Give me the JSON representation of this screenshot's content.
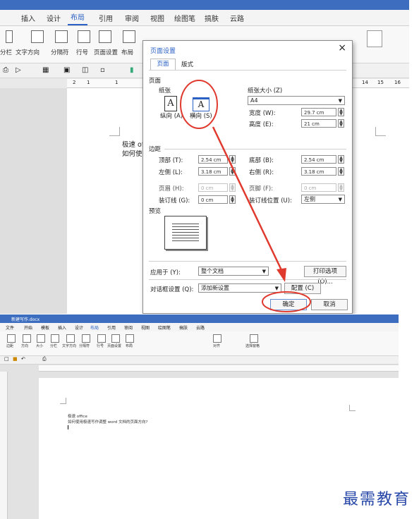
{
  "top_window": {
    "tabs": [
      "插入",
      "设计",
      "布局",
      "引用",
      "审阅",
      "视图",
      "绘图笔",
      "搞肤",
      "云路"
    ],
    "active_tab": "布局",
    "ribbon_labels": [
      "文字方向",
      "分隔符",
      "行号",
      "页面设置",
      "布局"
    ],
    "ribbon_left_fragment": "分栏",
    "ruler_numbers": [
      "2",
      "1",
      "1",
      "14",
      "15",
      "16"
    ],
    "doc_lines": [
      "极速 of",
      "如何使"
    ]
  },
  "dialog": {
    "title": "页面设置",
    "close_icon": "×",
    "tabs": [
      "页面",
      "版式"
    ],
    "section_page": "页面",
    "orientation_label": "纸张",
    "portrait_label": "纵向 (A)",
    "landscape_label": "横向 (S)",
    "paper_size_label": "纸张大小 (Z)",
    "paper_size_value": "A4",
    "width_label": "宽度 (W):",
    "width_value": "29.7 cm",
    "height_label": "高度 (E):",
    "height_value": "21 cm",
    "section_margins": "边距",
    "top_label": "顶部 (T):",
    "top_value": "2.54 cm",
    "bottom_label": "底部 (B):",
    "bottom_value": "2.54 cm",
    "left_label": "左侧 (L):",
    "left_value": "3.18 cm",
    "right_label": "右侧 (R):",
    "right_value": "3.18 cm",
    "header_label": "页眉 (H):",
    "header_value": "0 cm",
    "footer_label": "页脚 (F):",
    "footer_value": "0 cm",
    "gutter_label": "装订线 (G):",
    "gutter_value": "0 cm",
    "gutter_pos_label": "装订线位置 (U):",
    "gutter_pos_value": "左侧",
    "section_preview": "预览",
    "apply_label": "应用于 (Y):",
    "apply_value": "整个文档",
    "print_options": "打印选项 (O)...",
    "dialog_settings_label": "对话框设置 (Q):",
    "dialog_settings_value": "添加新设置",
    "config_button": "配置 (C)",
    "ok_button": "确定",
    "cancel_button": "取消"
  },
  "bottom_window": {
    "title": "新建写作.docx",
    "menu": [
      "文件",
      "开始",
      "模板",
      "插入",
      "设计",
      "布局",
      "引用",
      "审阅",
      "视图",
      "绘图笔",
      "搞肤",
      "云路"
    ],
    "active_menu": "布局",
    "ribbon_labels": [
      "边距",
      "方向",
      "大小",
      "分栏",
      "文字方向",
      "分隔符",
      "行号",
      "页面设置",
      "布局",
      "对齐",
      "选择窗格"
    ],
    "doc_line1": "极速 office",
    "doc_line2": "如何使用极速写作调整 word 文档的页面方向?"
  },
  "watermark": "最需教育",
  "colors": {
    "accent": "#2b61c4",
    "annotation": "#e03a2f",
    "brand": "#2747a8"
  }
}
